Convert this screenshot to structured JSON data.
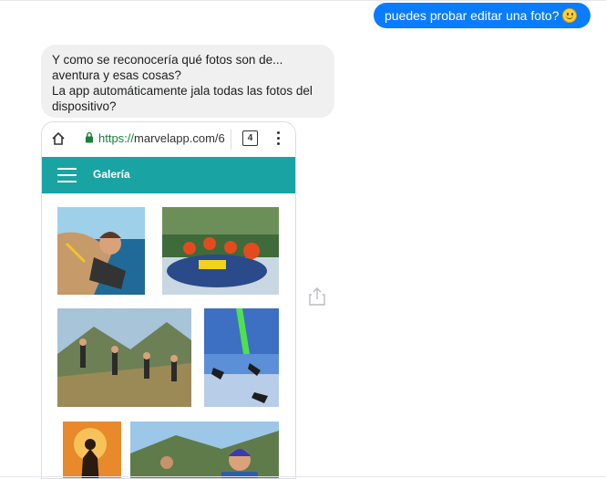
{
  "conversation": {
    "outgoing_message": "puedes probar editar una foto?",
    "incoming_message_lines": [
      "Y como se reconocería qué fotos son de...",
      "aventura y esas cosas?",
      "La app automáticamente jala todas las fotos del",
      "dispositivo?"
    ]
  },
  "screenshot": {
    "browser": {
      "url_scheme": "https://",
      "url_rest": "marvelapp.com/6",
      "tab_count": "4"
    },
    "app": {
      "title": "Galería"
    }
  },
  "colors": {
    "outgoing_bubble": "#0a7cff",
    "incoming_bubble": "#f0f0f0",
    "app_bar": "#1aa3a3"
  },
  "icons": [
    "smile-emoji-icon",
    "home-icon",
    "lock-icon",
    "tabs-icon",
    "more-vert-icon",
    "hamburger-menu-icon",
    "share-icon"
  ]
}
